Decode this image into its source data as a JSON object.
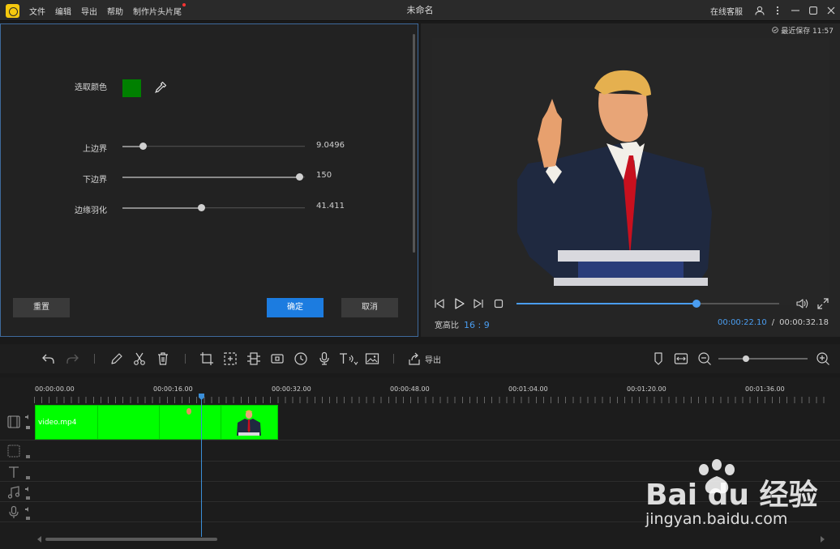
{
  "titlebar": {
    "menu": [
      "文件",
      "编辑",
      "导出",
      "帮助",
      "制作片头片尾"
    ],
    "title": "未命名",
    "support": "在线客服"
  },
  "key_panel": {
    "pick_color_label": "选取颜色",
    "picked_color": "#008000",
    "sliders": [
      {
        "label": "上边界",
        "value": "9.0496",
        "level": 0.11
      },
      {
        "label": "下边界",
        "value": "150",
        "level": 0.97
      },
      {
        "label": "边缘羽化",
        "value": "41.411",
        "level": 0.43
      }
    ],
    "reset_label": "重置",
    "ok_label": "确定",
    "cancel_label": "取消"
  },
  "preview": {
    "saved_text": "最近保存 11:57",
    "progress": 0.685,
    "aspect_label": "宽高比",
    "aspect_value": "16 : 9",
    "current_time": "00:00:22.10",
    "total_time": "00:00:32.18"
  },
  "toolbar": {
    "export_label": "导出",
    "zoom_level": 0.27
  },
  "timeline": {
    "ruler": [
      "00:00:00.00",
      "00:00:16.00",
      "00:00:32.00",
      "00:00:48.00",
      "00:01:04.00",
      "00:01:20.00",
      "00:01:36.00"
    ],
    "clip_name": "video.mp4",
    "clip_color": "#00ff00"
  },
  "watermark": {
    "brand": "Bai du 经验",
    "url": "jingyan.baidu.com"
  },
  "colors": {
    "accent": "#1c7ce0",
    "time_blue": "#4a9df0",
    "panel_border": "#3e6a9c"
  }
}
